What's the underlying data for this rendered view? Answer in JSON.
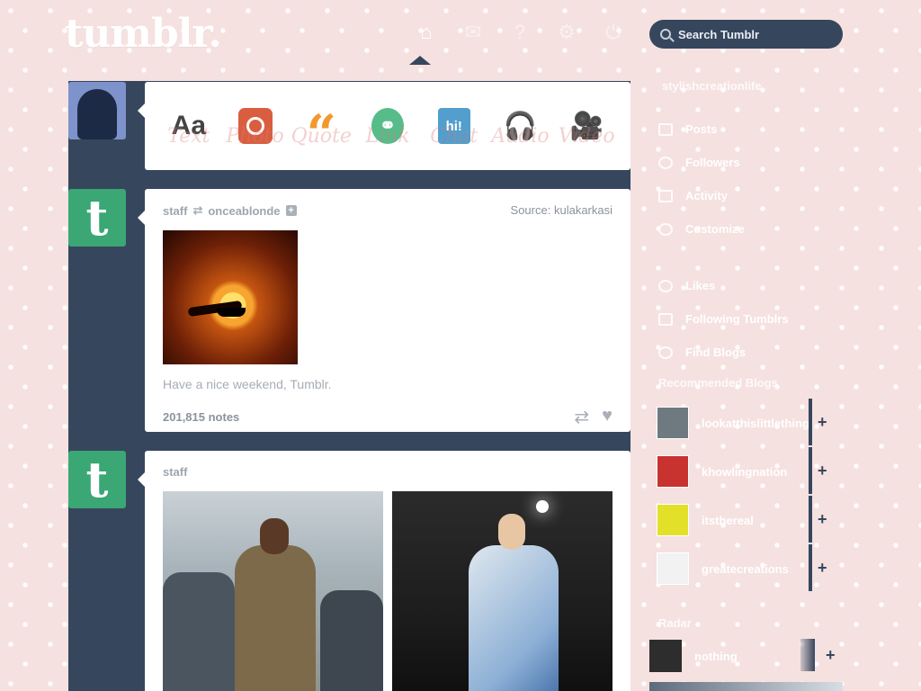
{
  "header": {
    "logo": "tumblr.",
    "nav": [
      {
        "name": "home",
        "glyph": "⌂"
      },
      {
        "name": "inbox",
        "glyph": "✉"
      },
      {
        "name": "help",
        "glyph": "?"
      },
      {
        "name": "settings",
        "glyph": "⚙"
      },
      {
        "name": "logout",
        "glyph": "⏻"
      }
    ],
    "search_placeholder": "Search Tumblr"
  },
  "post_types": [
    {
      "icon": "Aa",
      "label": "Text",
      "color": "#444444"
    },
    {
      "icon": "",
      "label": "Photo",
      "color": "#d95e40"
    },
    {
      "icon": "“",
      "label": "Quote",
      "color": "#f2992e"
    },
    {
      "icon": "⚭",
      "label": "Link",
      "color": "#56bc8a"
    },
    {
      "icon": "hi!",
      "label": "Chat",
      "color": "#529ecc"
    },
    {
      "icon": "🎧",
      "label": "Audio",
      "color": "#a77dc2"
    },
    {
      "icon": "🎥",
      "label": "Video",
      "color": "#748089"
    }
  ],
  "posts": [
    {
      "author": "staff",
      "reblogged_from": "onceablonde",
      "source_label": "Source:",
      "source": "kulakarkasi",
      "caption": "Have a nice weekend, Tumblr.",
      "notes": "201,815 notes"
    },
    {
      "author": "staff"
    }
  ],
  "sidebar": {
    "blog_name": "stylishcreationlife",
    "menu": [
      {
        "label": "Posts",
        "icon": "posts-icon"
      },
      {
        "label": "Followers",
        "icon": "followers-icon"
      },
      {
        "label": "Activity",
        "icon": "activity-icon"
      },
      {
        "label": "Customize",
        "icon": "customize-icon"
      },
      {
        "label": "Likes",
        "icon": "likes-icon"
      },
      {
        "label": "Following Tumblrs",
        "icon": "following-icon"
      },
      {
        "label": "Find Blogs",
        "icon": "find-blogs-icon"
      }
    ],
    "recommended_title": "Recommended Blogs",
    "recommended": [
      {
        "name": "lookatthislittlething"
      },
      {
        "name": "khowlingnation"
      },
      {
        "name": "itsthereal"
      },
      {
        "name": "greatecreations"
      }
    ],
    "radar_title": "Radar",
    "radar": {
      "name": "nothing"
    }
  },
  "colors": {
    "dashboard_navy": "#36465d",
    "background_pink": "#f5e1e0",
    "staff_green": "#3aa775"
  }
}
